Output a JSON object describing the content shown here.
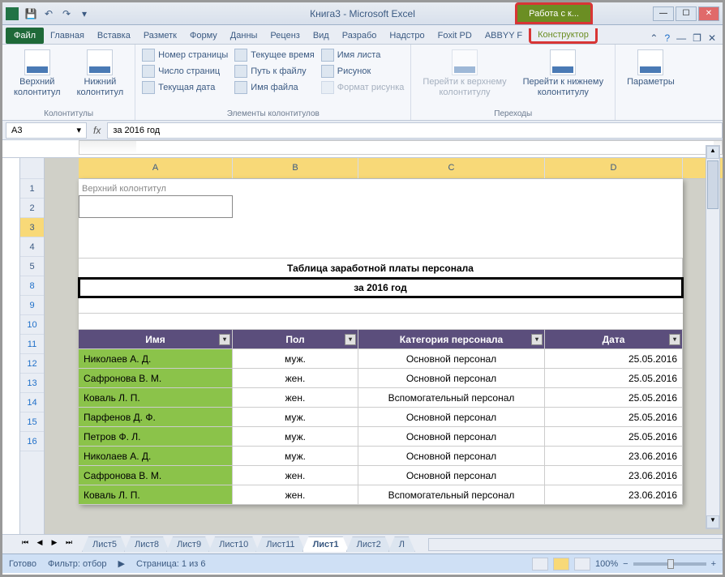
{
  "title": "Книга3 - Microsoft Excel",
  "contextual_title": "Работа с к...",
  "tabs": {
    "file": "Файл",
    "items": [
      "Главная",
      "Вставка",
      "Разметк",
      "Форму",
      "Данны",
      "Реценз",
      "Вид",
      "Разрабо",
      "Надстро",
      "Foxit PD",
      "ABBYY F"
    ],
    "context": "Конструктор"
  },
  "ribbon": {
    "group1": {
      "label": "Колонтитулы",
      "header_btn": "Верхний\nколонтитул",
      "footer_btn": "Нижний\nколонтитул"
    },
    "group2": {
      "label": "Элементы колонтитулов",
      "items": [
        "Номер страницы",
        "Число страниц",
        "Текущая дата",
        "Текущее время",
        "Путь к файлу",
        "Имя файла",
        "Имя листа",
        "Рисунок",
        "Формат рисунка"
      ]
    },
    "group3": {
      "label": "Переходы",
      "goto_header": "Перейти к верхнему\nколонтитулу",
      "goto_footer": "Перейти к нижнему\nколонтитулу"
    },
    "group4": {
      "params": "Параметры"
    }
  },
  "namebox": "A3",
  "formula": "за 2016 год",
  "columns": [
    "A",
    "B",
    "C",
    "D"
  ],
  "header_label": "Верхний колонтитул",
  "table": {
    "title": "Таблица заработной платы персонала",
    "subtitle": "за 2016 год",
    "headers": [
      "Имя",
      "Пол",
      "Категория персонала",
      "Дата"
    ],
    "rows": [
      [
        "Николаев А. Д.",
        "муж.",
        "Основной персонал",
        "25.05.2016"
      ],
      [
        "Сафронова В. М.",
        "жен.",
        "Основной персонал",
        "25.05.2016"
      ],
      [
        "Коваль Л. П.",
        "жен.",
        "Вспомогательный персонал",
        "25.05.2016"
      ],
      [
        "Парфенов Д. Ф.",
        "муж.",
        "Основной персонал",
        "25.05.2016"
      ],
      [
        "Петров Ф. Л.",
        "муж.",
        "Основной персонал",
        "25.05.2016"
      ],
      [
        "Николаев А. Д.",
        "муж.",
        "Основной персонал",
        "23.06.2016"
      ],
      [
        "Сафронова В. М.",
        "жен.",
        "Основной персонал",
        "23.06.2016"
      ],
      [
        "Коваль Л. П.",
        "жен.",
        "Вспомогательный персонал",
        "23.06.2016"
      ]
    ]
  },
  "rownums": [
    "",
    "1",
    "2",
    "3",
    "4",
    "5",
    "8",
    "9",
    "10",
    "11",
    "12",
    "13",
    "14",
    "15",
    "16"
  ],
  "sheets": [
    "Лист5",
    "Лист8",
    "Лист9",
    "Лист10",
    "Лист11",
    "Лист1",
    "Лист2",
    "Л"
  ],
  "active_sheet": "Лист1",
  "status": {
    "ready": "Готово",
    "filter": "Фильтр: отбор",
    "page": "Страница: 1 из 6",
    "zoom": "100%"
  }
}
